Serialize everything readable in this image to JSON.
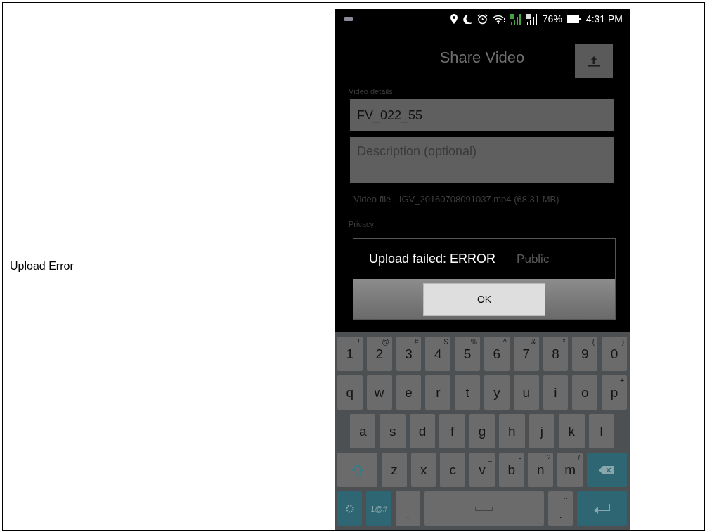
{
  "table": {
    "label": "Upload Error"
  },
  "phone": {
    "status_bar": {
      "battery": "76%",
      "time": "4:31 PM"
    },
    "title": "Share Video",
    "section_label": "Video details",
    "name_field": {
      "value": "FV_022_55"
    },
    "description_field": {
      "placeholder": "Description (optional)"
    },
    "file_info": "Video file - IGV_20160708091037.mp4 (68.31 MB)",
    "privacy_label": "Privacy",
    "privacy_value": "Public",
    "dialog": {
      "message": "Upload failed: ERROR",
      "button": "OK"
    },
    "keyboard": [
      [
        {
          "kind": "char",
          "label": "1",
          "hint": "!"
        },
        {
          "kind": "char",
          "label": "2",
          "hint": "@"
        },
        {
          "kind": "char",
          "label": "3",
          "hint": "#"
        },
        {
          "kind": "char",
          "label": "4",
          "hint": "$"
        },
        {
          "kind": "char",
          "label": "5",
          "hint": "%"
        },
        {
          "kind": "char",
          "label": "6",
          "hint": "^"
        },
        {
          "kind": "char",
          "label": "7",
          "hint": "&"
        },
        {
          "kind": "char",
          "label": "8",
          "hint": "*"
        },
        {
          "kind": "char",
          "label": "9",
          "hint": "("
        },
        {
          "kind": "char",
          "label": "0",
          "hint": ")"
        }
      ],
      [
        {
          "kind": "char",
          "label": "q"
        },
        {
          "kind": "char",
          "label": "w"
        },
        {
          "kind": "char",
          "label": "e"
        },
        {
          "kind": "char",
          "label": "r"
        },
        {
          "kind": "char",
          "label": "t"
        },
        {
          "kind": "char",
          "label": "y"
        },
        {
          "kind": "char",
          "label": "u"
        },
        {
          "kind": "char",
          "label": "i"
        },
        {
          "kind": "char",
          "label": "o"
        },
        {
          "kind": "char",
          "label": "p",
          "hint": "+"
        }
      ],
      [
        {
          "kind": "char",
          "label": "a"
        },
        {
          "kind": "char",
          "label": "s"
        },
        {
          "kind": "char",
          "label": "d"
        },
        {
          "kind": "char",
          "label": "f"
        },
        {
          "kind": "char",
          "label": "g"
        },
        {
          "kind": "char",
          "label": "h"
        },
        {
          "kind": "char",
          "label": "j"
        },
        {
          "kind": "char",
          "label": "k"
        },
        {
          "kind": "char",
          "label": "l"
        }
      ],
      [
        {
          "kind": "shift"
        },
        {
          "kind": "char",
          "label": "z"
        },
        {
          "kind": "char",
          "label": "x"
        },
        {
          "kind": "char",
          "label": "c"
        },
        {
          "kind": "char",
          "label": "v",
          "hint": "_"
        },
        {
          "kind": "char",
          "label": "b",
          "hint": "-"
        },
        {
          "kind": "char",
          "label": "n",
          "hint": "?"
        },
        {
          "kind": "char",
          "label": "m",
          "hint": "/"
        },
        {
          "kind": "backspace"
        }
      ],
      [
        {
          "kind": "settings"
        },
        {
          "kind": "symbols",
          "label": "1@#"
        },
        {
          "kind": "char",
          "label": ","
        },
        {
          "kind": "space"
        },
        {
          "kind": "char",
          "label": ".",
          "hint": "…"
        },
        {
          "kind": "enter"
        }
      ]
    ]
  }
}
